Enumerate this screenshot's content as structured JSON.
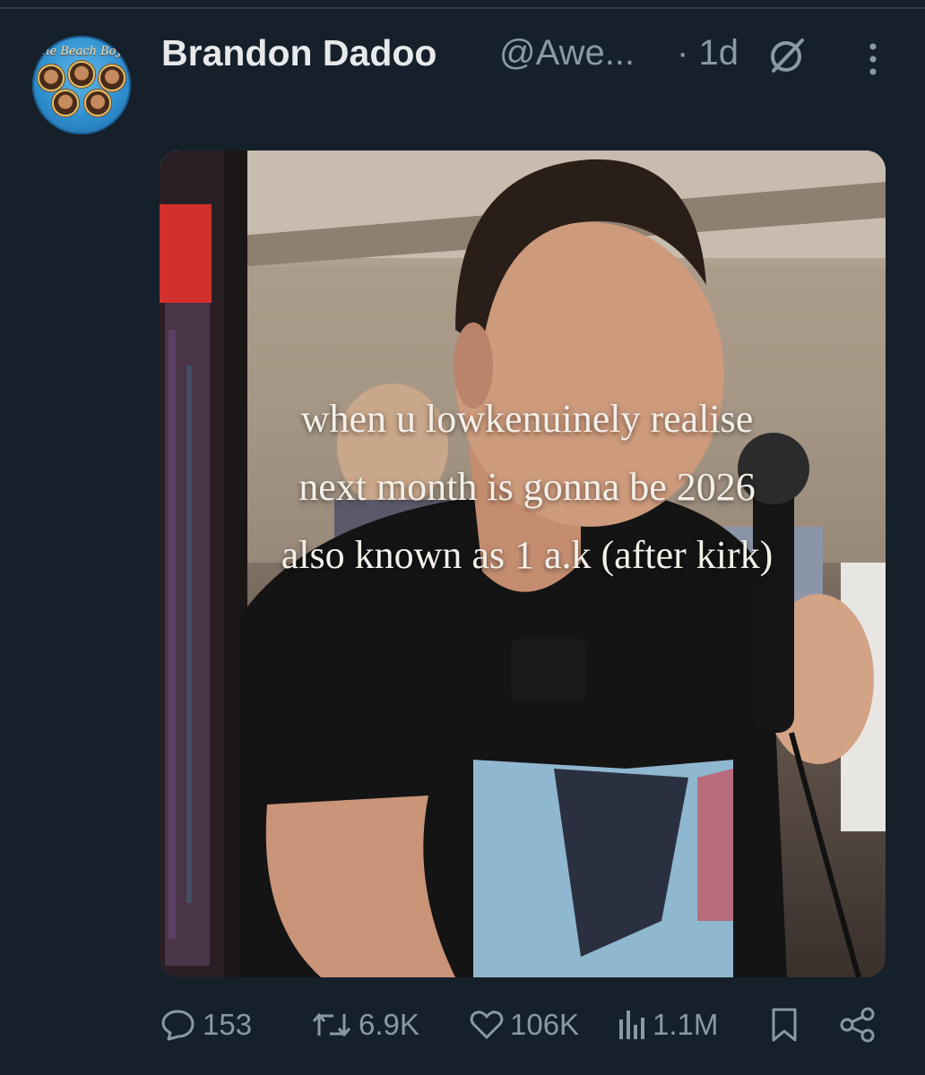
{
  "tweet": {
    "author_name": "Brandon Dadoo",
    "author_handle": "@Awe...",
    "separator": "·",
    "timestamp": "1d",
    "avatar_brand": "The Beach Boys",
    "media": {
      "caption_lines": [
        "when u lowkenuinely realise",
        "next month is gonna be 2026",
        "also known as 1 a.k (after kirk)"
      ]
    },
    "actions": {
      "replies": "153",
      "reposts": "6.9K",
      "likes": "106K",
      "views": "1.1M"
    }
  },
  "colors": {
    "background": "#15202b",
    "primary_text": "#e7e9ea",
    "secondary_text": "#8b98a5"
  },
  "icons": [
    "grok-icon",
    "more-icon",
    "reply-icon",
    "repost-icon",
    "like-icon",
    "views-icon",
    "bookmark-icon",
    "share-icon"
  ]
}
